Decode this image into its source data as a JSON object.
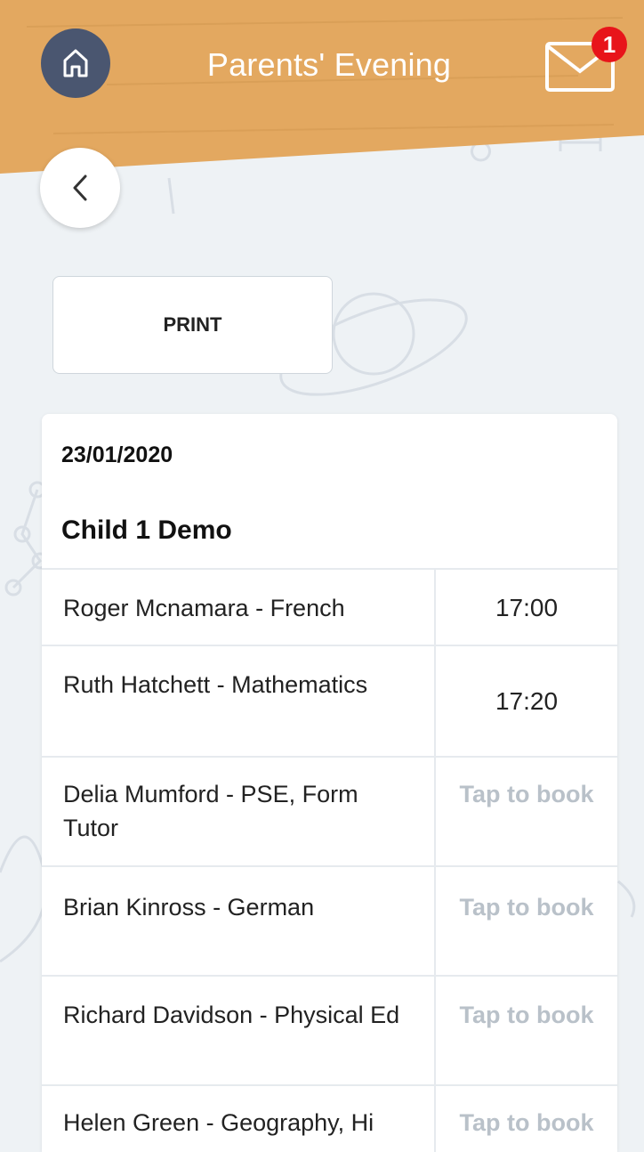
{
  "header": {
    "title": "Parents' Evening",
    "unread_count": "1",
    "band_color": "#e3a860",
    "home_color": "#4a5670",
    "badge_color": "#e8141a"
  },
  "actions": {
    "print_label": "PRINT"
  },
  "booking": {
    "date": "23/01/2020",
    "child_name": "Child 1 Demo",
    "rows": [
      {
        "teacher": "Roger Mcnamara - French",
        "slot": "17:00",
        "booked": true
      },
      {
        "teacher": "Ruth Hatchett - Mathematics",
        "slot": "17:20",
        "booked": true
      },
      {
        "teacher": "Delia Mumford - PSE, Form Tutor",
        "slot": "Tap to book",
        "booked": false
      },
      {
        "teacher": "Brian Kinross - German",
        "slot": "Tap to book",
        "booked": false
      },
      {
        "teacher": "Richard Davidson - Physical Ed",
        "slot": "Tap to book",
        "booked": false
      },
      {
        "teacher": "Helen Green - Geography, Hi",
        "slot": "Tap to book",
        "booked": false
      }
    ]
  },
  "icons": {
    "home": "home-icon",
    "mail": "mail-icon",
    "back": "chevron-left-icon"
  }
}
